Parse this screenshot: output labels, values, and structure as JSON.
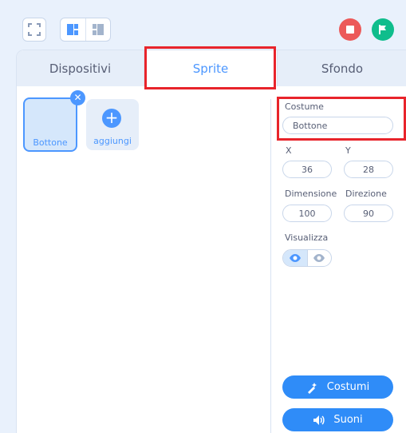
{
  "toolbar": {
    "fullscreen_icon": "fullscreen-icon",
    "layout_icons": [
      "layout-large-icon",
      "layout-small-icon"
    ],
    "stop_icon": "stop-icon",
    "stop_color": "#ec5959",
    "flag_icon": "green-flag-icon",
    "flag_color": "#0fbd8c"
  },
  "tabs": [
    {
      "label": "Dispositivi",
      "active": false
    },
    {
      "label": "Sprite",
      "active": true
    },
    {
      "label": "Sfondo",
      "active": false
    }
  ],
  "sprites": {
    "items": [
      {
        "name": "Bottone",
        "selected": true
      }
    ],
    "add_label": "aggiungi",
    "delete_icon": "delete-icon",
    "add_icon": "plus-icon"
  },
  "properties": {
    "costume_label": "Costume",
    "costume_value": "Bottone",
    "x_label": "X",
    "x_value": "36",
    "y_label": "Y",
    "y_value": "28",
    "size_label": "Dimensione",
    "size_value": "100",
    "direction_label": "Direzione",
    "direction_value": "90",
    "visibility_label": "Visualizza",
    "visibility_state": "visible"
  },
  "buttons": {
    "costumes_label": "Costumi",
    "costumes_icon": "costume-brush-icon",
    "sounds_label": "Suoni",
    "sounds_icon": "speaker-icon"
  },
  "colors": {
    "accent": "#4c97ff",
    "button": "#2f8cf8",
    "highlight_box": "#e8242b"
  }
}
